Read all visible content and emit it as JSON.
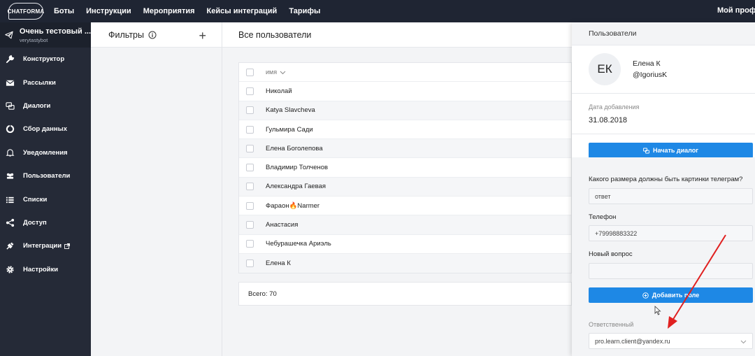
{
  "nav": {
    "logo": "CHATFORMA",
    "items": [
      "Боты",
      "Инструкции",
      "Мероприятия",
      "Кейсы интеграций",
      "Тарифы"
    ],
    "profile": "Мой профиль"
  },
  "sidebar": {
    "bot_name": "Очень тестовый ...",
    "bot_username": "verytastybot",
    "items": [
      {
        "label": "Конструктор",
        "icon": "wrench-icon"
      },
      {
        "label": "Рассылки",
        "icon": "envelope-icon"
      },
      {
        "label": "Диалоги",
        "icon": "chat-icon"
      },
      {
        "label": "Сбор данных",
        "icon": "pie-chart-icon"
      },
      {
        "label": "Уведомления",
        "icon": "bell-icon"
      },
      {
        "label": "Пользователи",
        "icon": "users-icon"
      },
      {
        "label": "Списки",
        "icon": "list-icon"
      },
      {
        "label": "Доступ",
        "icon": "share-icon"
      },
      {
        "label": "Интеграции",
        "icon": "plug-icon"
      },
      {
        "label": "Настройки",
        "icon": "gear-icon"
      }
    ]
  },
  "filters": {
    "title": "Фильтры"
  },
  "main": {
    "title": "Все пользователи",
    "column_name": "имя",
    "rows": [
      "Николай",
      "Katya Slavcheva",
      "Гульмира Сади",
      "Елена Боголепова",
      "Владимир Толченов",
      "Александра Гаевая",
      "Фараон🔥Narmer",
      "Анастасия",
      "Чебурашечка Ариэль",
      "Елена К"
    ],
    "total": "Всего: 70"
  },
  "panel": {
    "title": "Пользователи",
    "avatar_initials": "ЕК",
    "user_name": "Елена К",
    "user_handle": "@IgoriusK",
    "date_label": "Дата добавления",
    "date_value": "31.08.2018",
    "start_dialog": "Начать диалог",
    "q1_label": "Какого размера должны быть картинки телеграм?",
    "q1_value": "ответ",
    "phone_label": "Телефон",
    "phone_value": "+79998883322",
    "new_q_label": "Новый вопрос",
    "new_q_value": "",
    "add_field": "Добавить поле",
    "responsible_label": "Ответственный",
    "responsible_value": "pro.learn.client@yandex.ru"
  },
  "colors": {
    "accent": "#1e88e5",
    "sidebar": "#252a37",
    "annotation_arrow": "#e02020"
  }
}
